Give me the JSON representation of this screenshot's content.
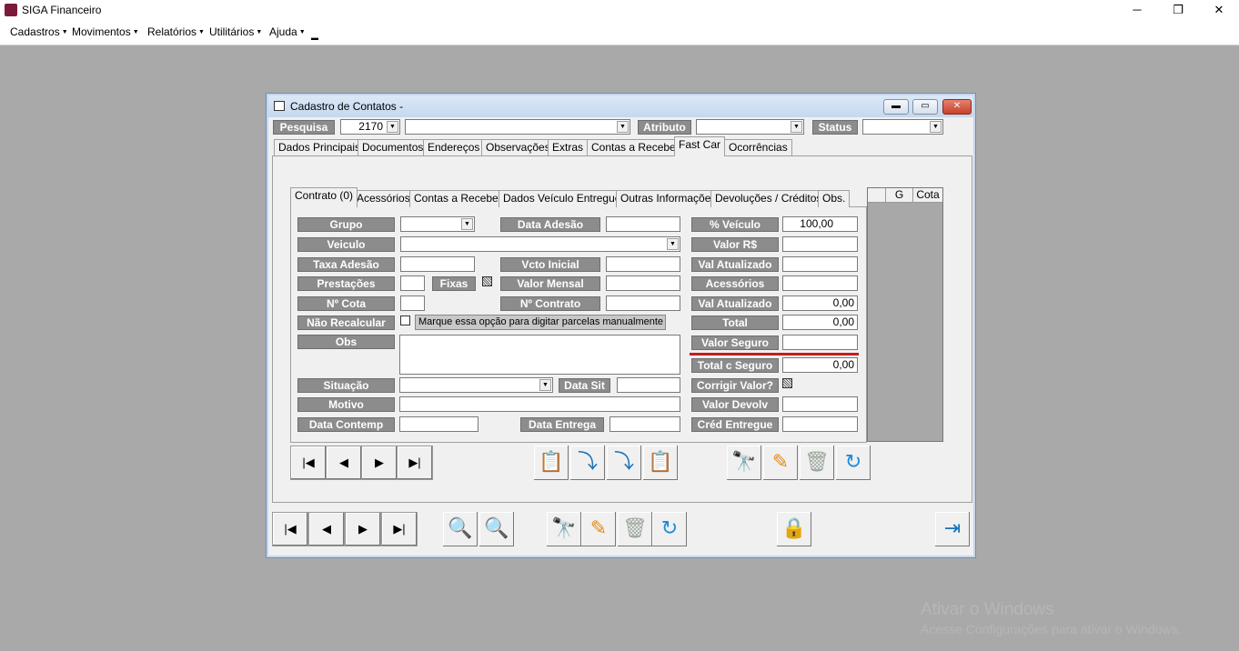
{
  "app": {
    "title": "SIGA Financeiro"
  },
  "window_controls": {
    "minimize": "─",
    "restore": "❐",
    "close": "✕"
  },
  "menu": [
    {
      "label": "Cadastros"
    },
    {
      "label": "Movimentos"
    },
    {
      "label": "Relatórios"
    },
    {
      "label": "Utilitários"
    },
    {
      "label": "Ajuda"
    }
  ],
  "form": {
    "title": "Cadastro de Contatos -",
    "search": {
      "pesquisa_label": "Pesquisa",
      "pesquisa_value": "2170",
      "pesquisa_text": "",
      "atributo_label": "Atributo",
      "atributo_value": "",
      "status_label": "Status",
      "status_value": ""
    },
    "tabs": [
      "Dados Principais",
      "Documentos",
      "Endereços",
      "Observações",
      "Extras",
      "Contas a Receber",
      "Fast Car",
      "Ocorrências"
    ],
    "active_tab": "Fast Car",
    "subtabs": [
      "Contrato (0)",
      "Acessórios",
      "Contas a Receber",
      "Dados Veículo Entregue",
      "Outras Informações",
      "Devoluções / Créditos",
      "Obs."
    ],
    "active_subtab": "Contrato (0)",
    "side_grid": {
      "col_g": "G",
      "col_cota": "Cota"
    },
    "contract": {
      "grupo_label": "Grupo",
      "grupo_value": "",
      "data_adesao_label": "Data Adesão",
      "data_adesao_value": "",
      "pct_veiculo_label": "% Veículo",
      "pct_veiculo_value": "100,00",
      "veiculo_label": "Veiculo",
      "veiculo_value": "",
      "valor_rs_label": "Valor R$",
      "valor_rs_value": "",
      "taxa_adesao_label": "Taxa Adesão",
      "taxa_adesao_value": "",
      "vcto_inicial_label": "Vcto Inicial",
      "vcto_inicial_value": "",
      "val_atualizado1_label": "Val Atualizado",
      "val_atualizado1_value": "",
      "prestacoes_label": "Prestações",
      "prestacoes_value": "",
      "fixas_label": "Fixas",
      "valor_mensal_label": "Valor Mensal",
      "valor_mensal_value": "",
      "acessorios_label": "Acessórios",
      "acessorios_value": "",
      "n_cota_label": "Nº Cota",
      "n_cota_value": "",
      "n_contrato_label": "Nº Contrato",
      "n_contrato_value": "",
      "val_atualizado2_label": "Val Atualizado",
      "val_atualizado2_value": "0,00",
      "nao_recalcular_label": "Não Recalcular",
      "nao_recalcular_hint": "Marque essa opção para digitar parcelas manualmente",
      "total_label": "Total",
      "total_value": "0,00",
      "obs_label": "Obs",
      "obs_value": "",
      "valor_seguro_label": "Valor Seguro",
      "valor_seguro_value": "",
      "total_c_seguro_label": "Total c Seguro",
      "total_c_seguro_value": "0,00",
      "situacao_label": "Situação",
      "situacao_value": "",
      "data_sit_label": "Data Sit",
      "data_sit_value": "",
      "corrigir_valor_label": "Corrigir Valor?",
      "motivo_label": "Motivo",
      "motivo_value": "",
      "valor_devolv_label": "Valor Devolv",
      "valor_devolv_value": "",
      "data_contemp_label": "Data Contemp",
      "data_contemp_value": "",
      "data_entrega_label": "Data Entrega",
      "data_entrega_value": "",
      "cred_entregue_label": "Créd Entregue",
      "cred_entregue_value": ""
    },
    "nav_glyphs": {
      "first": "|◀",
      "prev": "◀",
      "next": "▶",
      "last": "▶|"
    }
  },
  "watermark": {
    "line1": "Ativar o Windows",
    "line2": "Acesse Configurações para ativar o Windows."
  }
}
